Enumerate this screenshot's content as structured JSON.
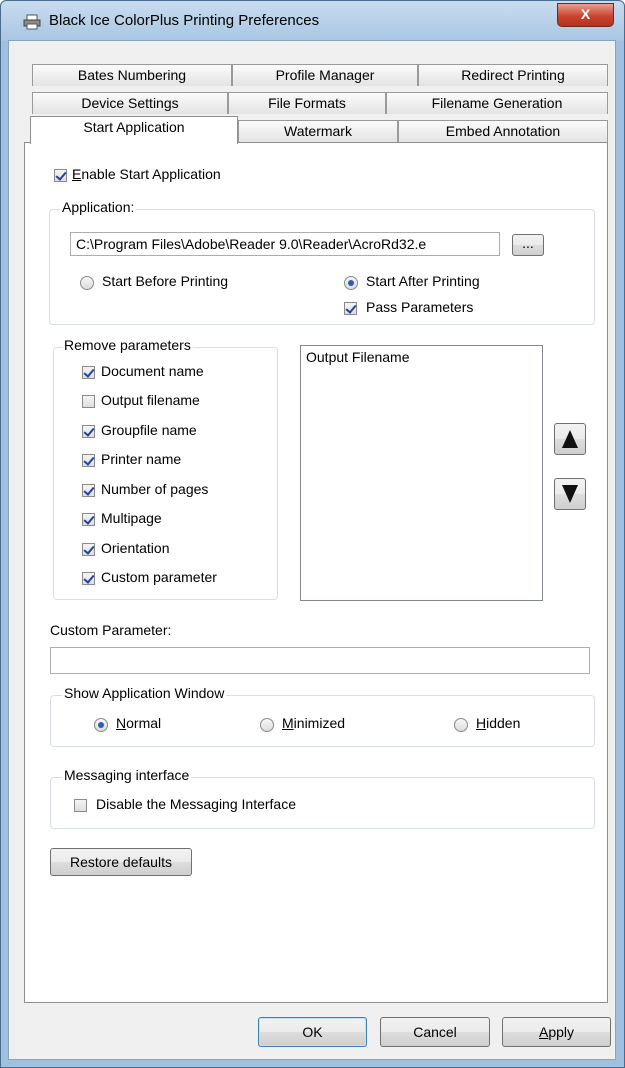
{
  "window": {
    "title": "Black Ice ColorPlus Printing Preferences",
    "close_glyph": "X"
  },
  "tabs": {
    "row1": [
      "Bates Numbering",
      "Profile Manager",
      "Redirect Printing"
    ],
    "row2": [
      "Device Settings",
      "File Formats",
      "Filename Generation"
    ],
    "row3": [
      "Start Application",
      "Watermark",
      "Embed Annotation"
    ],
    "active": "Start Application"
  },
  "enable_start": {
    "label": "Enable Start Application",
    "checked": true
  },
  "application_group": {
    "legend": "Application:",
    "path": "C:\\Program Files\\Adobe\\Reader 9.0\\Reader\\AcroRd32.e",
    "browse_label": "...",
    "start_before": {
      "label": "Start Before Printing",
      "checked": false
    },
    "start_after": {
      "label": "Start After Printing",
      "checked": true
    },
    "pass_parameters": {
      "label": "Pass Parameters",
      "checked": true
    }
  },
  "remove_params": {
    "legend": "Remove parameters",
    "items": [
      {
        "label": "Document name",
        "checked": true
      },
      {
        "label": "Output filename",
        "checked": false
      },
      {
        "label": "Groupfile name",
        "checked": true
      },
      {
        "label": "Printer name",
        "checked": true
      },
      {
        "label": "Number of pages",
        "checked": true
      },
      {
        "label": "Multipage",
        "checked": true
      },
      {
        "label": "Orientation",
        "checked": true
      },
      {
        "label": "Custom parameter",
        "checked": true
      }
    ]
  },
  "parameter_list": {
    "items": [
      "Output Filename"
    ]
  },
  "custom_parameter": {
    "label": "Custom Parameter:",
    "value": ""
  },
  "show_window": {
    "legend": "Show Application Window",
    "normal": {
      "label": "Normal",
      "checked": true
    },
    "minimized": {
      "label": "Minimized",
      "checked": false
    },
    "hidden": {
      "label": "Hidden",
      "checked": false
    }
  },
  "messaging": {
    "legend": "Messaging interface",
    "disable": {
      "label": "Disable the Messaging Interface",
      "checked": false
    }
  },
  "buttons": {
    "restore": "Restore defaults",
    "ok": "OK",
    "cancel": "Cancel",
    "apply": "Apply"
  }
}
